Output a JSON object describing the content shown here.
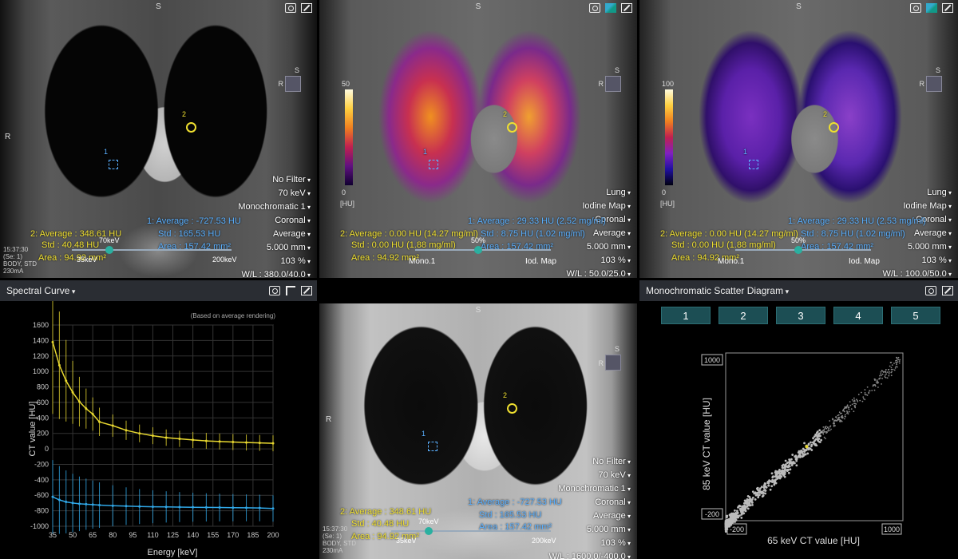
{
  "colors": {
    "yellow": "#f0e030",
    "blue": "#5ab0ff",
    "teal": "#1c4e54"
  },
  "icons": [
    "camera-icon",
    "layers-icon",
    "maximize-icon",
    "pointer-icon",
    "cube-icon"
  ],
  "orientation": {
    "superior": "S",
    "right": "R"
  },
  "meta": {
    "time": "15:37:30",
    "series": "(Se: 1)",
    "body": "BODY, STD",
    "mA": "230mA"
  },
  "top_left": {
    "filter": "No Filter",
    "energy": "70 keV",
    "mode": "Monochromatic 1",
    "plane": "Coronal",
    "render": "Average",
    "thickness": "5.000 mm",
    "zoom": "103 %",
    "wl": "W/L : 380.0/40.0",
    "roi2": [
      "2: Average : 348.61 HU",
      "Std : 40.48 HU",
      "Area : 94.92 mm²"
    ],
    "roi1": [
      "1: Average : -727.53 HU",
      "Std : 165.53 HU",
      "Area : 157.42 mm²"
    ],
    "slider_left": "70keV",
    "slider_low": "35keV",
    "slider_high": "200keV",
    "marker1": "1",
    "marker2": "2"
  },
  "top_mid": {
    "scale_max": "50",
    "scale_min": "0",
    "scale_unit": "[HU]",
    "filter": "Lung",
    "mode": "Iodine Map",
    "plane": "Coronal",
    "render": "Average",
    "thickness": "5.000 mm",
    "zoom": "103 %",
    "wl": "W/L : 50.0/25.0",
    "roi2": [
      "2: Average : 0.00 HU (14.27 mg/ml)",
      "Std : 0.00 HU (1.88 mg/ml)",
      "Area : 94.92 mm²"
    ],
    "roi1": [
      "1: Average : 29.33 HU (2.52 mg/ml)",
      "Std : 8.75 HU (1.02 mg/ml)",
      "Area : 157.42 mm²"
    ],
    "slider_pct": "50%",
    "mono_label": "Mono.1",
    "iod_label": "Iod. Map",
    "marker1": "1",
    "marker2": "2"
  },
  "top_right": {
    "scale_max": "100",
    "scale_min": "0",
    "scale_unit": "[HU]",
    "filter": "Lung",
    "mode": "Iodine Map",
    "plane": "Coronal",
    "render": "Average",
    "thickness": "5.000 mm",
    "zoom": "103 %",
    "wl": "W/L : 100.0/50.0",
    "roi2": [
      "2: Average : 0.00 HU (14.27 mg/ml)",
      "Std : 0.00 HU (1.88 mg/ml)",
      "Area : 94.92 mm²"
    ],
    "roi1": [
      "1: Average : 29.33 HU (2.53 mg/ml)",
      "Std : 8.75 HU (1.02 mg/ml)",
      "Area : 157.42 mm²"
    ],
    "slider_pct": "50%",
    "mono_label": "Mono.1",
    "iod_label": "Iod. Map",
    "marker1": "1",
    "marker2": "2"
  },
  "bottom_mid": {
    "filter": "No Filter",
    "energy": "70 keV",
    "mode": "Monochromatic 1",
    "plane": "Coronal",
    "render": "Average",
    "thickness": "5.000 mm",
    "zoom": "103 %",
    "wl": "W/L : 1600.0/-400.0",
    "roi2": [
      "2: Average : 348.61 HU",
      "Std : 40.48 HU",
      "Area : 94.92 mm²"
    ],
    "roi1": [
      "1: Average : -727.53 HU",
      "Std : 165.53 HU",
      "Area : 157.42 mm²"
    ],
    "slider_left": "70keV",
    "slider_low": "35keV",
    "slider_high": "200keV",
    "marker1": "1",
    "marker2": "2"
  },
  "spectral": {
    "title": "Spectral Curve",
    "note": "(Based on average rendering)"
  },
  "scatter": {
    "title": "Monochromatic Scatter Diagram",
    "buttons": [
      "1",
      "2",
      "3",
      "4",
      "5"
    ]
  },
  "chart_data": [
    {
      "type": "line",
      "xlabel": "Energy [keV]",
      "ylabel": "CT value [HU]",
      "xlim": [
        35,
        200
      ],
      "ylim": [
        -1000,
        1600
      ],
      "x_ticks": [
        35,
        50,
        65,
        80,
        95,
        110,
        125,
        140,
        155,
        170,
        185,
        200
      ],
      "y_ticks": [
        1600,
        1400,
        1200,
        1000,
        800,
        600,
        400,
        200,
        0,
        -200,
        -400,
        -600,
        -800,
        -1000
      ],
      "grid": true,
      "x": [
        35,
        40,
        45,
        50,
        55,
        60,
        65,
        70,
        80,
        90,
        100,
        110,
        120,
        130,
        140,
        150,
        160,
        170,
        180,
        190,
        200
      ],
      "series": [
        {
          "values": [
            1380,
            1080,
            880,
            730,
            610,
            520,
            450,
            349,
            300,
            240,
            200,
            170,
            145,
            130,
            115,
            103,
            95,
            88,
            82,
            77,
            72
          ],
          "color": "#e8d830"
        },
        {
          "values": [
            -620,
            -660,
            -685,
            -700,
            -710,
            -715,
            -720,
            -727,
            -735,
            -740,
            -745,
            -748,
            -750,
            -752,
            -754,
            -756,
            -758,
            -760,
            -762,
            -764,
            -770
          ],
          "color": "#30a8e8"
        }
      ]
    },
    {
      "type": "scatter",
      "xlabel": "65 keV CT value [HU]",
      "ylabel": "85 keV CT value [HU]",
      "xlim": [
        -200,
        1000
      ],
      "ylim": [
        -200,
        1000
      ],
      "x_ticks": [
        -200,
        1000
      ],
      "y_ticks": [
        1000,
        -200
      ],
      "grid": false
    }
  ]
}
